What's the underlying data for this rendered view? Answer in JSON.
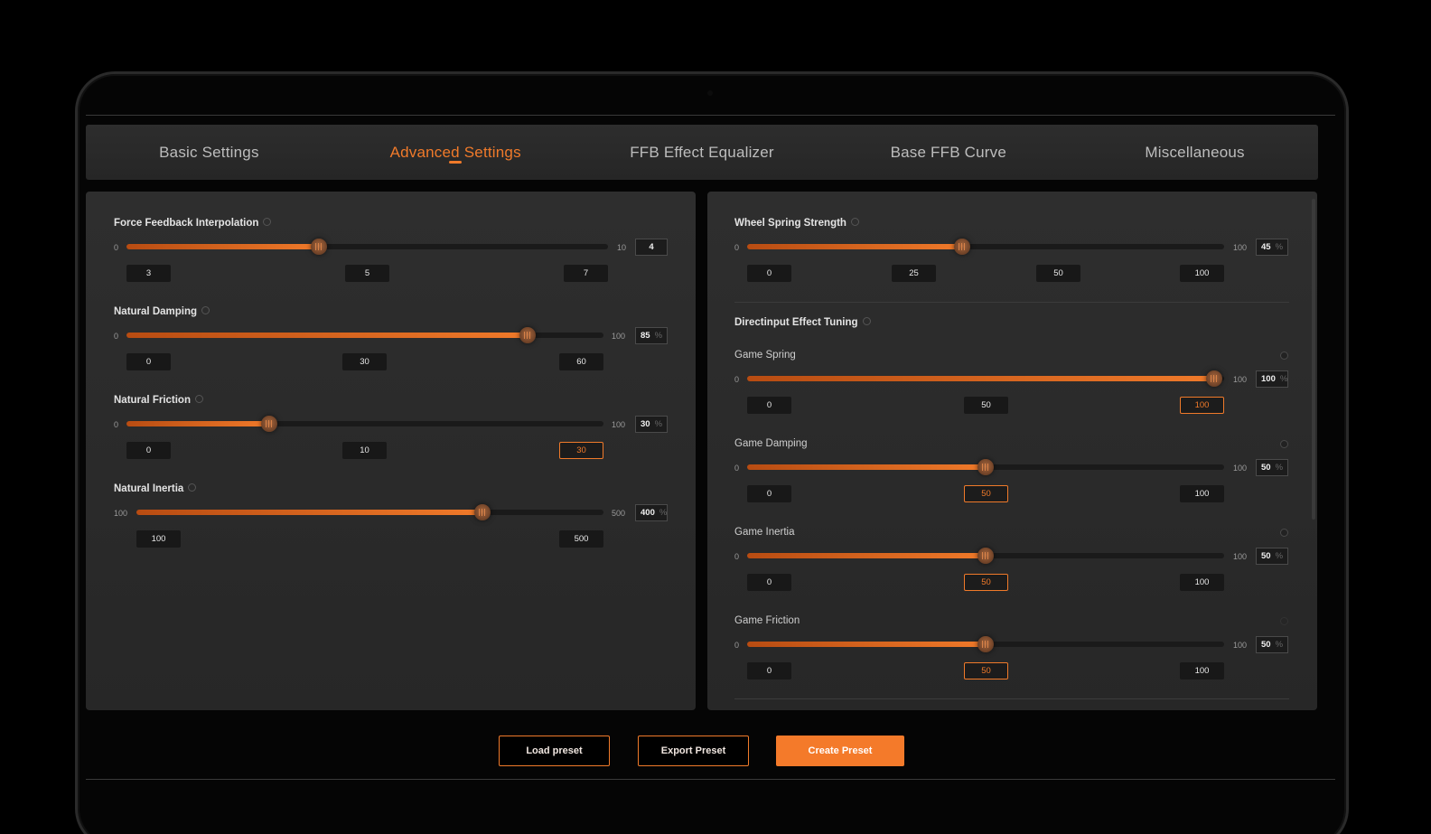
{
  "tabs": [
    {
      "label": "Basic Settings"
    },
    {
      "label": "Advanced Settings"
    },
    {
      "label": "FFB Effect Equalizer"
    },
    {
      "label": "Base FFB Curve"
    },
    {
      "label": "Miscellaneous"
    }
  ],
  "active_tab": "Advanced Settings",
  "accent_color": "#f07a2a",
  "left": {
    "ffi": {
      "label": "Force Feedback Interpolation",
      "min": "0",
      "max": "10",
      "value": "4",
      "level": 0.4,
      "presets": [
        "3",
        "5",
        "7"
      ]
    },
    "damping": {
      "label": "Natural Damping",
      "min": "0",
      "max": "100",
      "value": "85",
      "unit": "%",
      "level": 0.85,
      "presets": [
        "0",
        "30",
        "60"
      ]
    },
    "friction": {
      "label": "Natural Friction",
      "min": "0",
      "max": "100",
      "value": "30",
      "unit": "%",
      "level": 0.3,
      "presets": [
        "0",
        "10",
        "30"
      ],
      "selected": "30"
    },
    "inertia": {
      "label": "Natural Inertia",
      "min": "100",
      "max": "500",
      "value": "400",
      "unit": "%",
      "level": 0.75,
      "presets": [
        "100",
        "500"
      ]
    }
  },
  "right": {
    "wheel_spring": {
      "label": "Wheel Spring Strength",
      "min": "0",
      "max": "100",
      "value": "45",
      "unit": "%",
      "level": 0.45,
      "presets": [
        "0",
        "25",
        "50",
        "100"
      ]
    },
    "section_title": "Directinput Effect Tuning",
    "game_spring": {
      "label": "Game Spring",
      "min": "0",
      "max": "100",
      "value": "100",
      "unit": "%",
      "level": 1.0,
      "presets": [
        "0",
        "50",
        "100"
      ],
      "selected": "100"
    },
    "game_damping": {
      "label": "Game Damping",
      "min": "0",
      "max": "100",
      "value": "50",
      "unit": "%",
      "level": 0.5,
      "presets": [
        "0",
        "50",
        "100"
      ],
      "selected": "50"
    },
    "game_inertia": {
      "label": "Game Inertia",
      "min": "0",
      "max": "100",
      "value": "50",
      "unit": "%",
      "level": 0.5,
      "presets": [
        "0",
        "50",
        "100"
      ],
      "selected": "50"
    },
    "game_friction": {
      "label": "Game Friction",
      "min": "0",
      "max": "100",
      "value": "50",
      "unit": "%",
      "level": 0.5,
      "presets": [
        "0",
        "50",
        "100"
      ],
      "selected": "50"
    }
  },
  "buttons": {
    "load": "Load preset",
    "export": "Export Preset",
    "create": "Create Preset"
  }
}
